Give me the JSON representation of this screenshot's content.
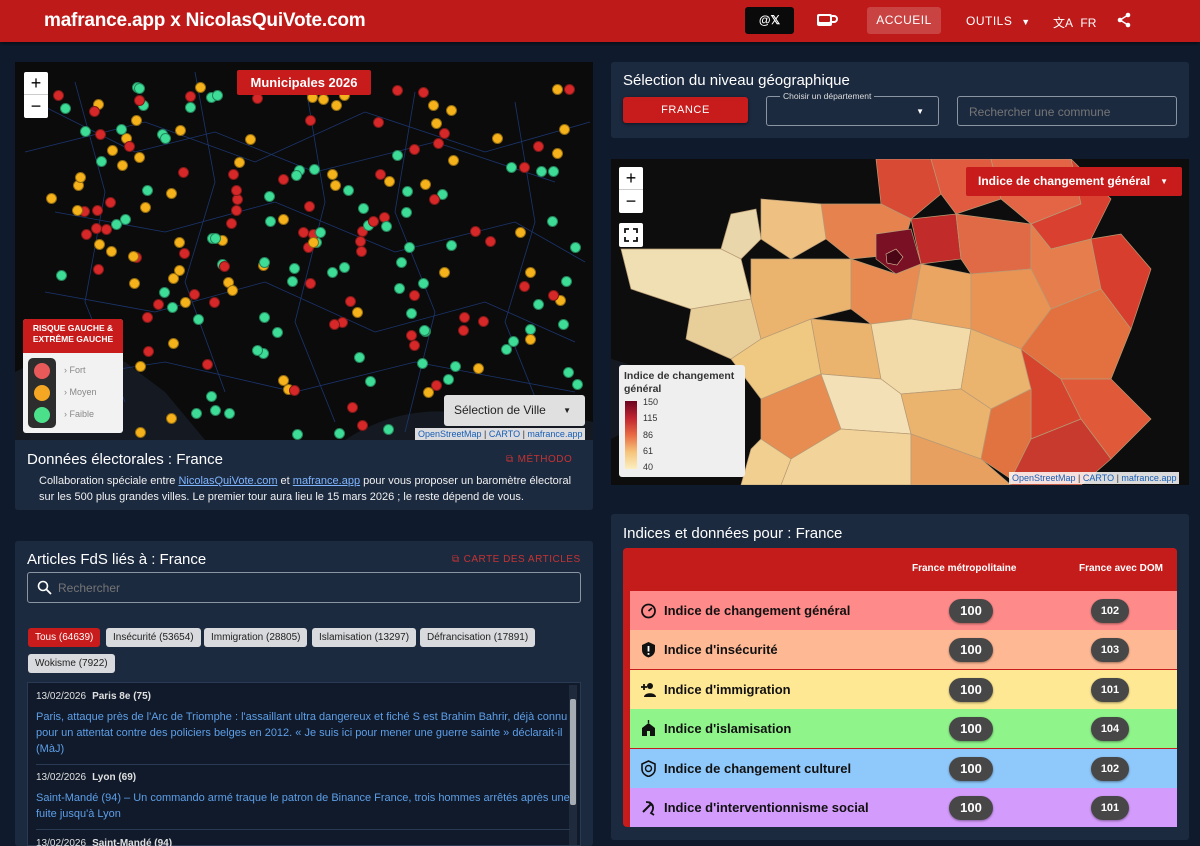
{
  "header": {
    "brand": "mafrance.app x NicolasQuiVote.com",
    "x_button": "@𝕏",
    "nav_home": "ACCUEIL",
    "nav_tools": "OUTILS",
    "nav_lang": "FR"
  },
  "left_map": {
    "badge": "Municipales 2026",
    "legend_title": "RISQUE GAUCHE & EXTRÊME GAUCHE",
    "legend_items": [
      "Fort",
      "Moyen",
      "Faible"
    ],
    "city_select": "Sélection de Ville",
    "attribution": [
      "OpenStreetMap",
      "CARTO",
      "mafrance.app"
    ],
    "colors": {
      "fort": "#d62828",
      "moyen": "#f5b21a",
      "faible": "#3ddc97"
    }
  },
  "electoral": {
    "title": "Données électorales : France",
    "method_link": "MÉTHODO",
    "text_prefix": "Collaboration spéciale entre",
    "link1": "NicolasQuiVote.com",
    "text_and": "et",
    "link2": "mafrance.app",
    "text_suffix": "pour vous proposer un baromètre électoral sur les 500 plus grandes villes. Le premier tour aura lieu le 15 mars 2026 ; le reste dépend de vous."
  },
  "articles": {
    "title": "Articles FdS liés à : France",
    "map_link": "CARTE DES ARTICLES",
    "search_placeholder": "Rechercher",
    "chips": [
      "Tous (64639)",
      "Insécurité (53654)",
      "Immigration (28805)",
      "Islamisation (13297)",
      "Défrancisation (17891)",
      "Wokisme (7922)"
    ],
    "items": [
      {
        "date": "13/02/2026",
        "place": "Paris 8e (75)",
        "text": "Paris, attaque près de l'Arc de Triomphe : l'assaillant ultra dangereux et fiché S est Brahim Bahrir, déjà connu pour un attentat contre des policiers belges en 2012. « Je suis ici pour mener une guerre sainte » déclarait-il (MàJ)"
      },
      {
        "date": "13/02/2026",
        "place": "Lyon (69)",
        "text": "Saint-Mandé (94) – Un commando armé traque le patron de Binance France, trois hommes arrêtés après une fuite jusqu'à Lyon"
      },
      {
        "date": "13/02/2026",
        "place": "Saint-Mandé (94)",
        "text": ""
      }
    ]
  },
  "geo": {
    "title": "Sélection du niveau géographique",
    "france_button": "FRANCE",
    "dept_label": "Choisir un département",
    "commune_placeholder": "Rechercher une commune"
  },
  "right_map": {
    "index_select": "Indice de changement général",
    "legend_title": "Indice de changement général",
    "legend_ticks": [
      "150",
      "115",
      "86",
      "61",
      "40"
    ],
    "attribution": [
      "OpenStreetMap",
      "CARTO",
      "mafrance.app"
    ]
  },
  "indices": {
    "title": "Indices et données pour : France",
    "col1": "France métropolitaine",
    "col2": "France avec DOM",
    "rows": [
      {
        "label": "Indice de changement général",
        "icon": "gauge-icon",
        "v1": "100",
        "v2": "102",
        "color": "#ff8a8a"
      },
      {
        "label": "Indice d'insécurité",
        "icon": "shield-alert-icon",
        "v1": "100",
        "v2": "103",
        "color": "#ffb894"
      },
      {
        "label": "Indice d'immigration",
        "icon": "people-add-icon",
        "v1": "100",
        "v2": "101",
        "color": "#ffe894"
      },
      {
        "label": "Indice d'islamisation",
        "icon": "mosque-icon",
        "v1": "100",
        "v2": "104",
        "color": "#8ff58a"
      },
      {
        "label": "Indice de changement culturel",
        "icon": "culture-shield-icon",
        "v1": "100",
        "v2": "102",
        "color": "#8fc8fb"
      },
      {
        "label": "Indice d'interventionnisme social",
        "icon": "hammer-sickle-icon",
        "v1": "100",
        "v2": "101",
        "color": "#d39bfb"
      }
    ]
  }
}
